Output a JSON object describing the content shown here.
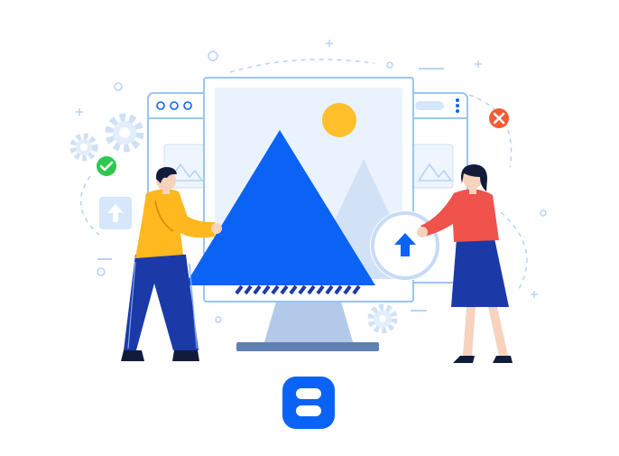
{
  "illustration": {
    "subject": "image-upload",
    "icons": [
      "gear-icon",
      "check-icon",
      "close-icon",
      "upload-arrow-icon",
      "image-placeholder-icon",
      "app-logo-icon"
    ],
    "colors": {
      "primary_blue": "#0a63f5",
      "navy": "#1b3aa8",
      "sun_yellow": "#ffc02a",
      "shirt_yellow": "#ffb81e",
      "shirt_red": "#f0524c",
      "success_green": "#2dc84d",
      "danger_orange": "#f25b34",
      "pale_blue": "#e9f2fd",
      "outline_blue": "#9cc4f2",
      "skin": "#f7d2bd"
    }
  }
}
